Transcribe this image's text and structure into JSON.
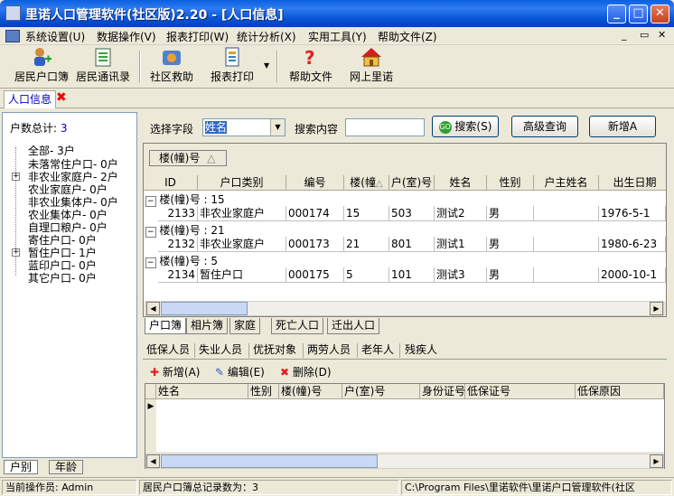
{
  "window": {
    "title": "里诺人口管理软件(社区版)2.20 - [人口信息]"
  },
  "menu": [
    "系统设置(U)",
    "数据操作(V)",
    "报表打印(W)",
    "统计分析(X)",
    "实用工具(Y)",
    "帮助文件(Z)"
  ],
  "toolbar": {
    "residents": "居民户口簿",
    "directory": "居民通讯录",
    "relief": "社区救助",
    "report": "报表打印",
    "help": "帮助文件",
    "online": "网上里诺"
  },
  "doc_tab": "人口信息",
  "left": {
    "total_label": "户数总计:",
    "total_value": "3",
    "tree": [
      "全部- 3户",
      "未落常住户口- 0户",
      "非农业家庭户- 2户",
      "农业家庭户- 0户",
      "非农业集体户- 0户",
      "农业集体户- 0户",
      "自理口粮户- 0户",
      "寄住户口- 0户",
      "暂住户口- 1户",
      "蓝印户口- 0户",
      "其它户口- 0户"
    ],
    "bottom_tabs": [
      "户别",
      "年龄"
    ]
  },
  "search": {
    "field_label": "选择字段",
    "field_value": "姓名",
    "content_label": "搜索内容",
    "content_value": "",
    "search_btn": "搜索(S)",
    "advanced_btn": "高级查询",
    "add_btn": "新增A"
  },
  "grid": {
    "group_chip": "楼(幢)号",
    "headers": [
      "ID",
      "户口类别",
      "编号",
      "楼(幢",
      "户(室)号",
      "姓名",
      "性别",
      "户主姓名",
      "出生日期"
    ],
    "groups": [
      {
        "label": "楼(幢)号 : 15",
        "row": [
          "2133",
          "非农业家庭户",
          "000174",
          "15",
          "503",
          "测试2",
          "男",
          "",
          "1976-5-1"
        ]
      },
      {
        "label": "楼(幢)号 : 21",
        "row": [
          "2132",
          "非农业家庭户",
          "000173",
          "21",
          "801",
          "测试1",
          "男",
          "",
          "1980-6-23"
        ]
      },
      {
        "label": "楼(幢)号 : 5",
        "row": [
          "2134",
          "暂住户口",
          "000175",
          "5",
          "101",
          "测试3",
          "男",
          "",
          "2000-10-1"
        ]
      }
    ]
  },
  "bottom_tabs": [
    "户口簿",
    "相片簿",
    "家庭",
    "死亡人口",
    "迁出人口"
  ],
  "sub_tabs": [
    "低保人员",
    "失业人员",
    "优抚对象",
    "两劳人员",
    "老年人",
    "残疾人"
  ],
  "sub_toolbar": {
    "add": "新增(A)",
    "edit": "编辑(E)",
    "delete": "删除(D)"
  },
  "sub_grid_headers": [
    "姓名",
    "性别",
    "楼(幢)号",
    "户(室)号",
    "身份证号",
    "低保证号",
    "低保原因"
  ],
  "status": {
    "operator": "当前操作员: Admin",
    "records": "居民户口簿总记录数为：3",
    "path": "C:\\Program Files\\里诺软件\\里诺户口管理软件(社区"
  },
  "colors": {
    "title_blue": "#0a5fe0",
    "accent": "#0000c0"
  }
}
